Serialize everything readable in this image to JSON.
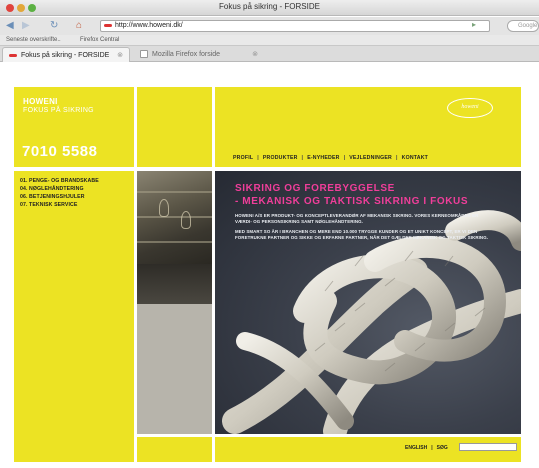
{
  "browser": {
    "window_title": "Fokus på sikring - FORSIDE",
    "url": "http://www.howeni.dk/",
    "search_placeholder": "Google",
    "back_glyph": "◀",
    "forward_glyph": "▶",
    "reload_glyph": "↻",
    "home_glyph": "⌂",
    "go_glyph": "▸",
    "bookmarks": [
      "Seneste overskrifte..",
      "Firefox Central"
    ],
    "tabs": [
      {
        "label": "Fokus på sikring - FORSIDE",
        "active": true
      },
      {
        "label": "Mozilla Firefox forside",
        "active": false
      }
    ],
    "tab_close_glyph": "⊗"
  },
  "site": {
    "brand_name": "HOWENI",
    "brand_tagline": "FOKUS PÅ SIKRING",
    "phone": "7010 5588",
    "logo_text": "howeni",
    "menu": [
      "PROFIL",
      "PRODUKTER",
      "E-NYHEDER",
      "VEJLEDNINGER",
      "KONTAKT"
    ],
    "menu_separator": "|",
    "sidebar": [
      "01. PENGE- OG BRANDSKABE",
      "04. NØGLEHÅNDTERING",
      "06. BETJENINGSHJULER",
      "07. TEKNISK SERVICE"
    ],
    "hero": {
      "heading_1": "SIKRING OG FOREBYGGELSE",
      "heading_2": "- MEKANISK OG TAKTISK SIKRING I FOKUS",
      "paragraph_1": "HOWENI A/S ER PRODUKT- OG KONCEPTLEVERANDØR AF MEKANISK SIKRING. VORES KERNEOMRÅDER ER VÆRDI- OG PERSONSIKRING SAMT NØGLEHÅNDTERING.",
      "paragraph_2": "MED SMART SO ÅR I BRANCHEN OG MERE END 10.000 TRYGGE KUNDER OG ET UNIKT KONCEPT, ER VI DEN FORETRUKNE PARTNER OG SIKKE OG ERFARNE PARTNER, NÅR DET GÆLDER MEKANISK OG TAKTISK SIKRING."
    },
    "footer": {
      "language": "ENGLISH",
      "separator": "|",
      "search_label": "SØG"
    }
  },
  "colors": {
    "brand_yellow": "#ece323",
    "hero_heading_pink": "#f03e9a"
  }
}
